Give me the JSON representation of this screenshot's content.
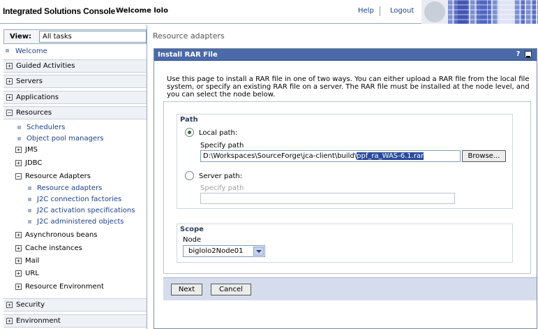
{
  "header": {
    "title": "Integrated Solutions Console",
    "welcome": "Welcome lolo",
    "help": "Help",
    "logout": "Logout"
  },
  "nav": {
    "view_label": "View:",
    "view_value": "All tasks",
    "welcome": "Welcome",
    "top_items": [
      {
        "label": "Guided Activities",
        "expanded": false
      },
      {
        "label": "Servers",
        "expanded": false
      },
      {
        "label": "Applications",
        "expanded": false
      },
      {
        "label": "Resources",
        "expanded": true
      },
      {
        "label": "Security",
        "expanded": false
      },
      {
        "label": "Environment",
        "expanded": false
      }
    ],
    "resources_children": [
      {
        "label": "Schedulers",
        "kind": "link"
      },
      {
        "label": "Object pool managers",
        "kind": "link"
      },
      {
        "label": "JMS",
        "kind": "folder"
      },
      {
        "label": "JDBC",
        "kind": "folder"
      },
      {
        "label": "Resource Adapters",
        "kind": "folder-open"
      },
      {
        "label": "Resource adapters",
        "kind": "link"
      },
      {
        "label": "J2C connection factories",
        "kind": "link"
      },
      {
        "label": "J2C activation specifications",
        "kind": "link"
      },
      {
        "label": "J2C administered objects",
        "kind": "link"
      },
      {
        "label": "Asynchronous beans",
        "kind": "folder"
      },
      {
        "label": "Cache instances",
        "kind": "folder"
      },
      {
        "label": "Mail",
        "kind": "folder"
      },
      {
        "label": "URL",
        "kind": "folder"
      },
      {
        "label": "Resource Environment",
        "kind": "folder"
      }
    ]
  },
  "main": {
    "breadcrumb": "Resource adapters",
    "panel_title": "Install RAR File",
    "panel_help": "?",
    "intro": "Use this page to install a RAR file in one of two ways. You can either upload a RAR file from the local file system, or specify an existing RAR file on a server. The RAR file must be installed at the node level, and you can select the node below.",
    "path": {
      "title": "Path",
      "local_label": "Local path:",
      "local_specify": "Specify path",
      "local_value_plain": "D:\\Workspaces\\SourceForge\\jca-client\\build\\",
      "local_value_selected": "ppf_ra_WAS-6.1.rar",
      "browse": "Browse...",
      "server_label": "Server path:",
      "server_specify": "Specify path",
      "server_value": ""
    },
    "scope": {
      "title": "Scope",
      "node_label": "Node",
      "node_value": "biglolo2Node01"
    },
    "buttons": {
      "next": "Next",
      "cancel": "Cancel"
    }
  }
}
